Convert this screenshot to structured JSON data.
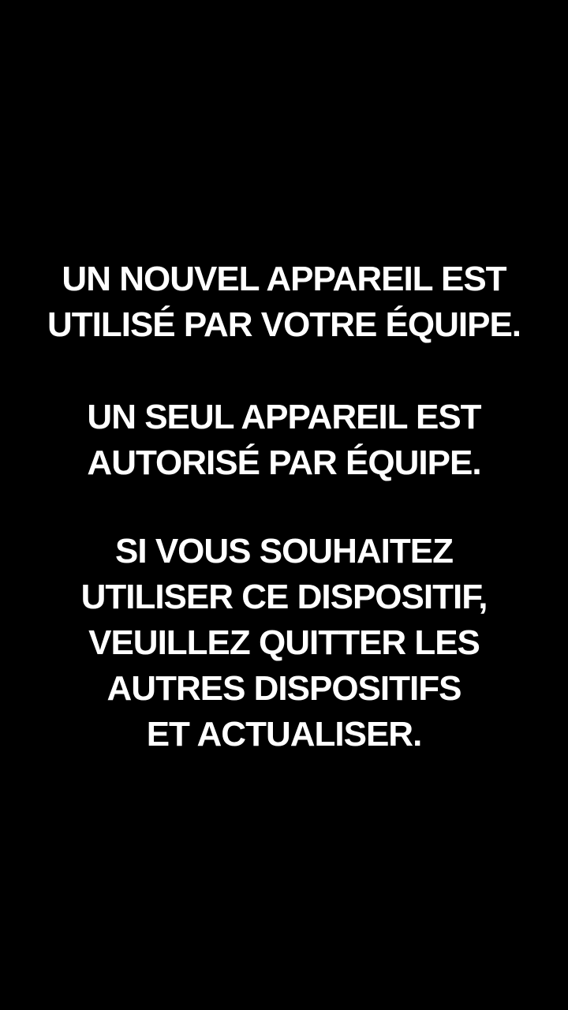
{
  "colors": {
    "background": "#000000",
    "text": "#ffffff"
  },
  "message": {
    "paragraph_1": [
      "UN NOUVEL APPAREIL EST",
      "UTILISÉ PAR VOTRE ÉQUIPE."
    ],
    "paragraph_2": [
      "UN SEUL APPAREIL EST",
      "AUTORISÉ PAR ÉQUIPE."
    ],
    "paragraph_3": [
      "SI VOUS SOUHAITEZ",
      "UTILISER CE DISPOSITIF,",
      "VEUILLEZ QUITTER LES",
      "AUTRES DISPOSITIFS",
      "ET ACTUALISER."
    ]
  }
}
